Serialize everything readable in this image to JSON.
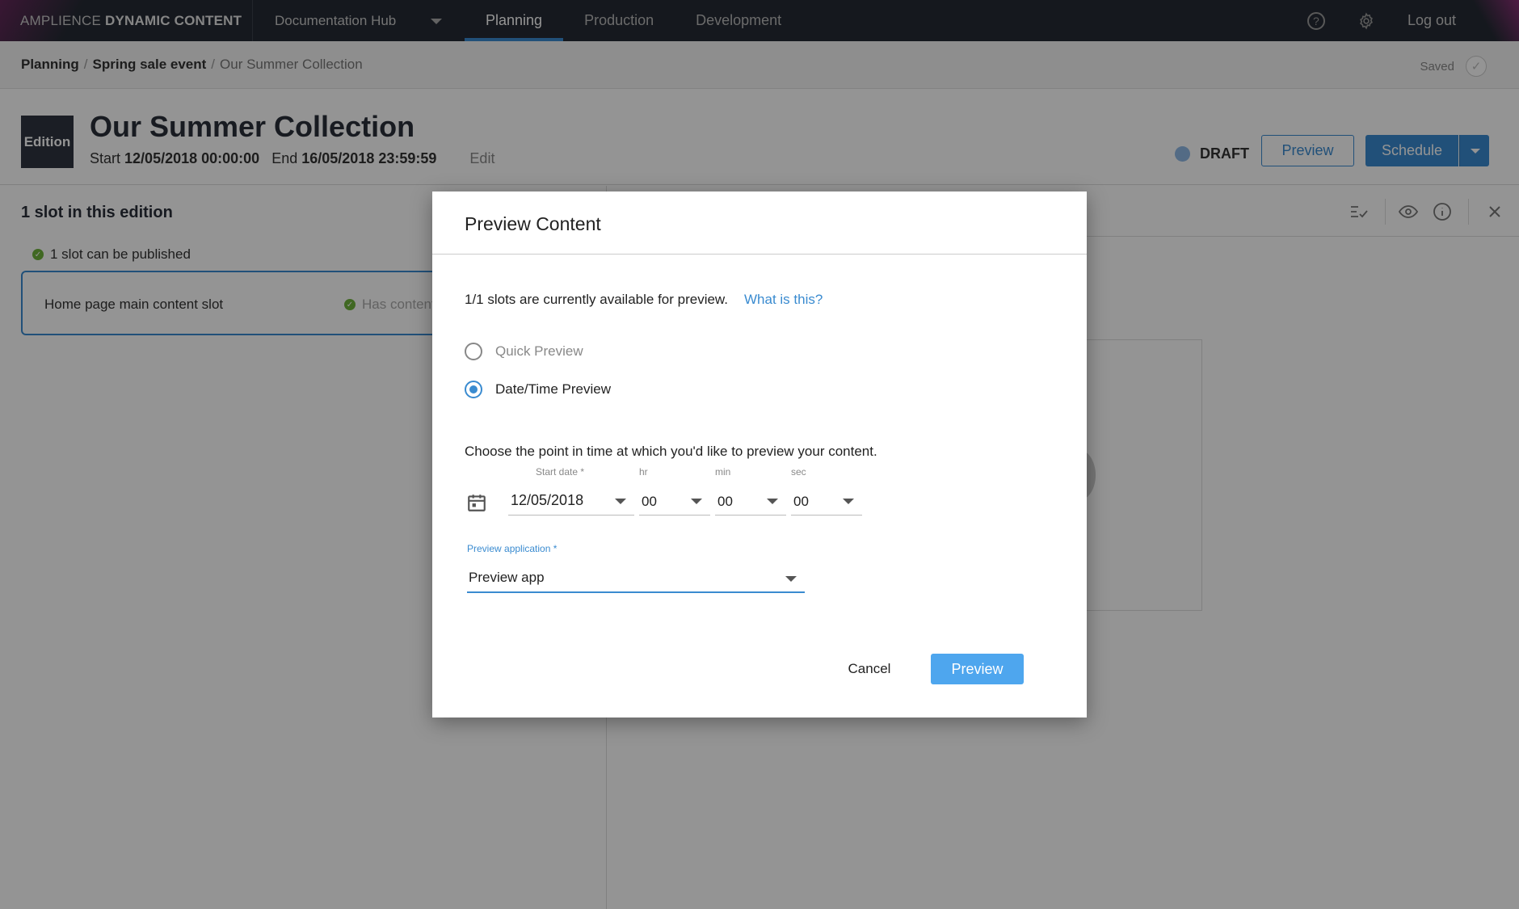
{
  "nav": {
    "brand_light": "AMPLIENCE ",
    "brand_bold": "DYNAMIC CONTENT",
    "hub": "Documentation Hub",
    "tabs": [
      {
        "label": "Planning",
        "active": true
      },
      {
        "label": "Production",
        "active": false
      },
      {
        "label": "Development",
        "active": false
      }
    ],
    "help_glyph": "?",
    "logout": "Log out"
  },
  "breadcrumb": {
    "items": [
      "Planning",
      "Spring sale event",
      "Our Summer Collection"
    ],
    "separator": "/",
    "saved": "Saved"
  },
  "edition": {
    "badge": "Edition",
    "title": "Our Summer Collection",
    "start_label": "Start",
    "start": "12/05/2018 00:00:00",
    "end_label": "End",
    "end": "16/05/2018 23:59:59",
    "edit": "Edit",
    "status": "DRAFT",
    "preview_button": "Preview",
    "schedule_button": "Schedule"
  },
  "slots": {
    "count_heading": "1 slot in this edition",
    "publishable": "1 slot can be published",
    "items": [
      {
        "name": "Home page main content slot",
        "status": "Has content"
      }
    ]
  },
  "dialog": {
    "title": "Preview Content",
    "availability": "1/1 slots are currently available for preview.",
    "what_link": "What is this?",
    "options": [
      {
        "label": "Quick Preview",
        "selected": false
      },
      {
        "label": "Date/Time Preview",
        "selected": true
      }
    ],
    "instruction": "Choose the point in time at which you'd like to preview your content.",
    "fields": {
      "start_date": {
        "label": "Start date *",
        "value": "12/05/2018"
      },
      "hr": {
        "label": "hr",
        "value": "00"
      },
      "min": {
        "label": "min",
        "value": "00"
      },
      "sec": {
        "label": "sec",
        "value": "00"
      }
    },
    "application": {
      "label": "Preview application *",
      "value": "Preview app"
    },
    "cancel": "Cancel",
    "confirm": "Preview"
  },
  "colors": {
    "accent": "#3a8bd0",
    "nav_bg": "#252a34",
    "success": "#6fb33c",
    "primary_button": "#4ea6ee"
  }
}
